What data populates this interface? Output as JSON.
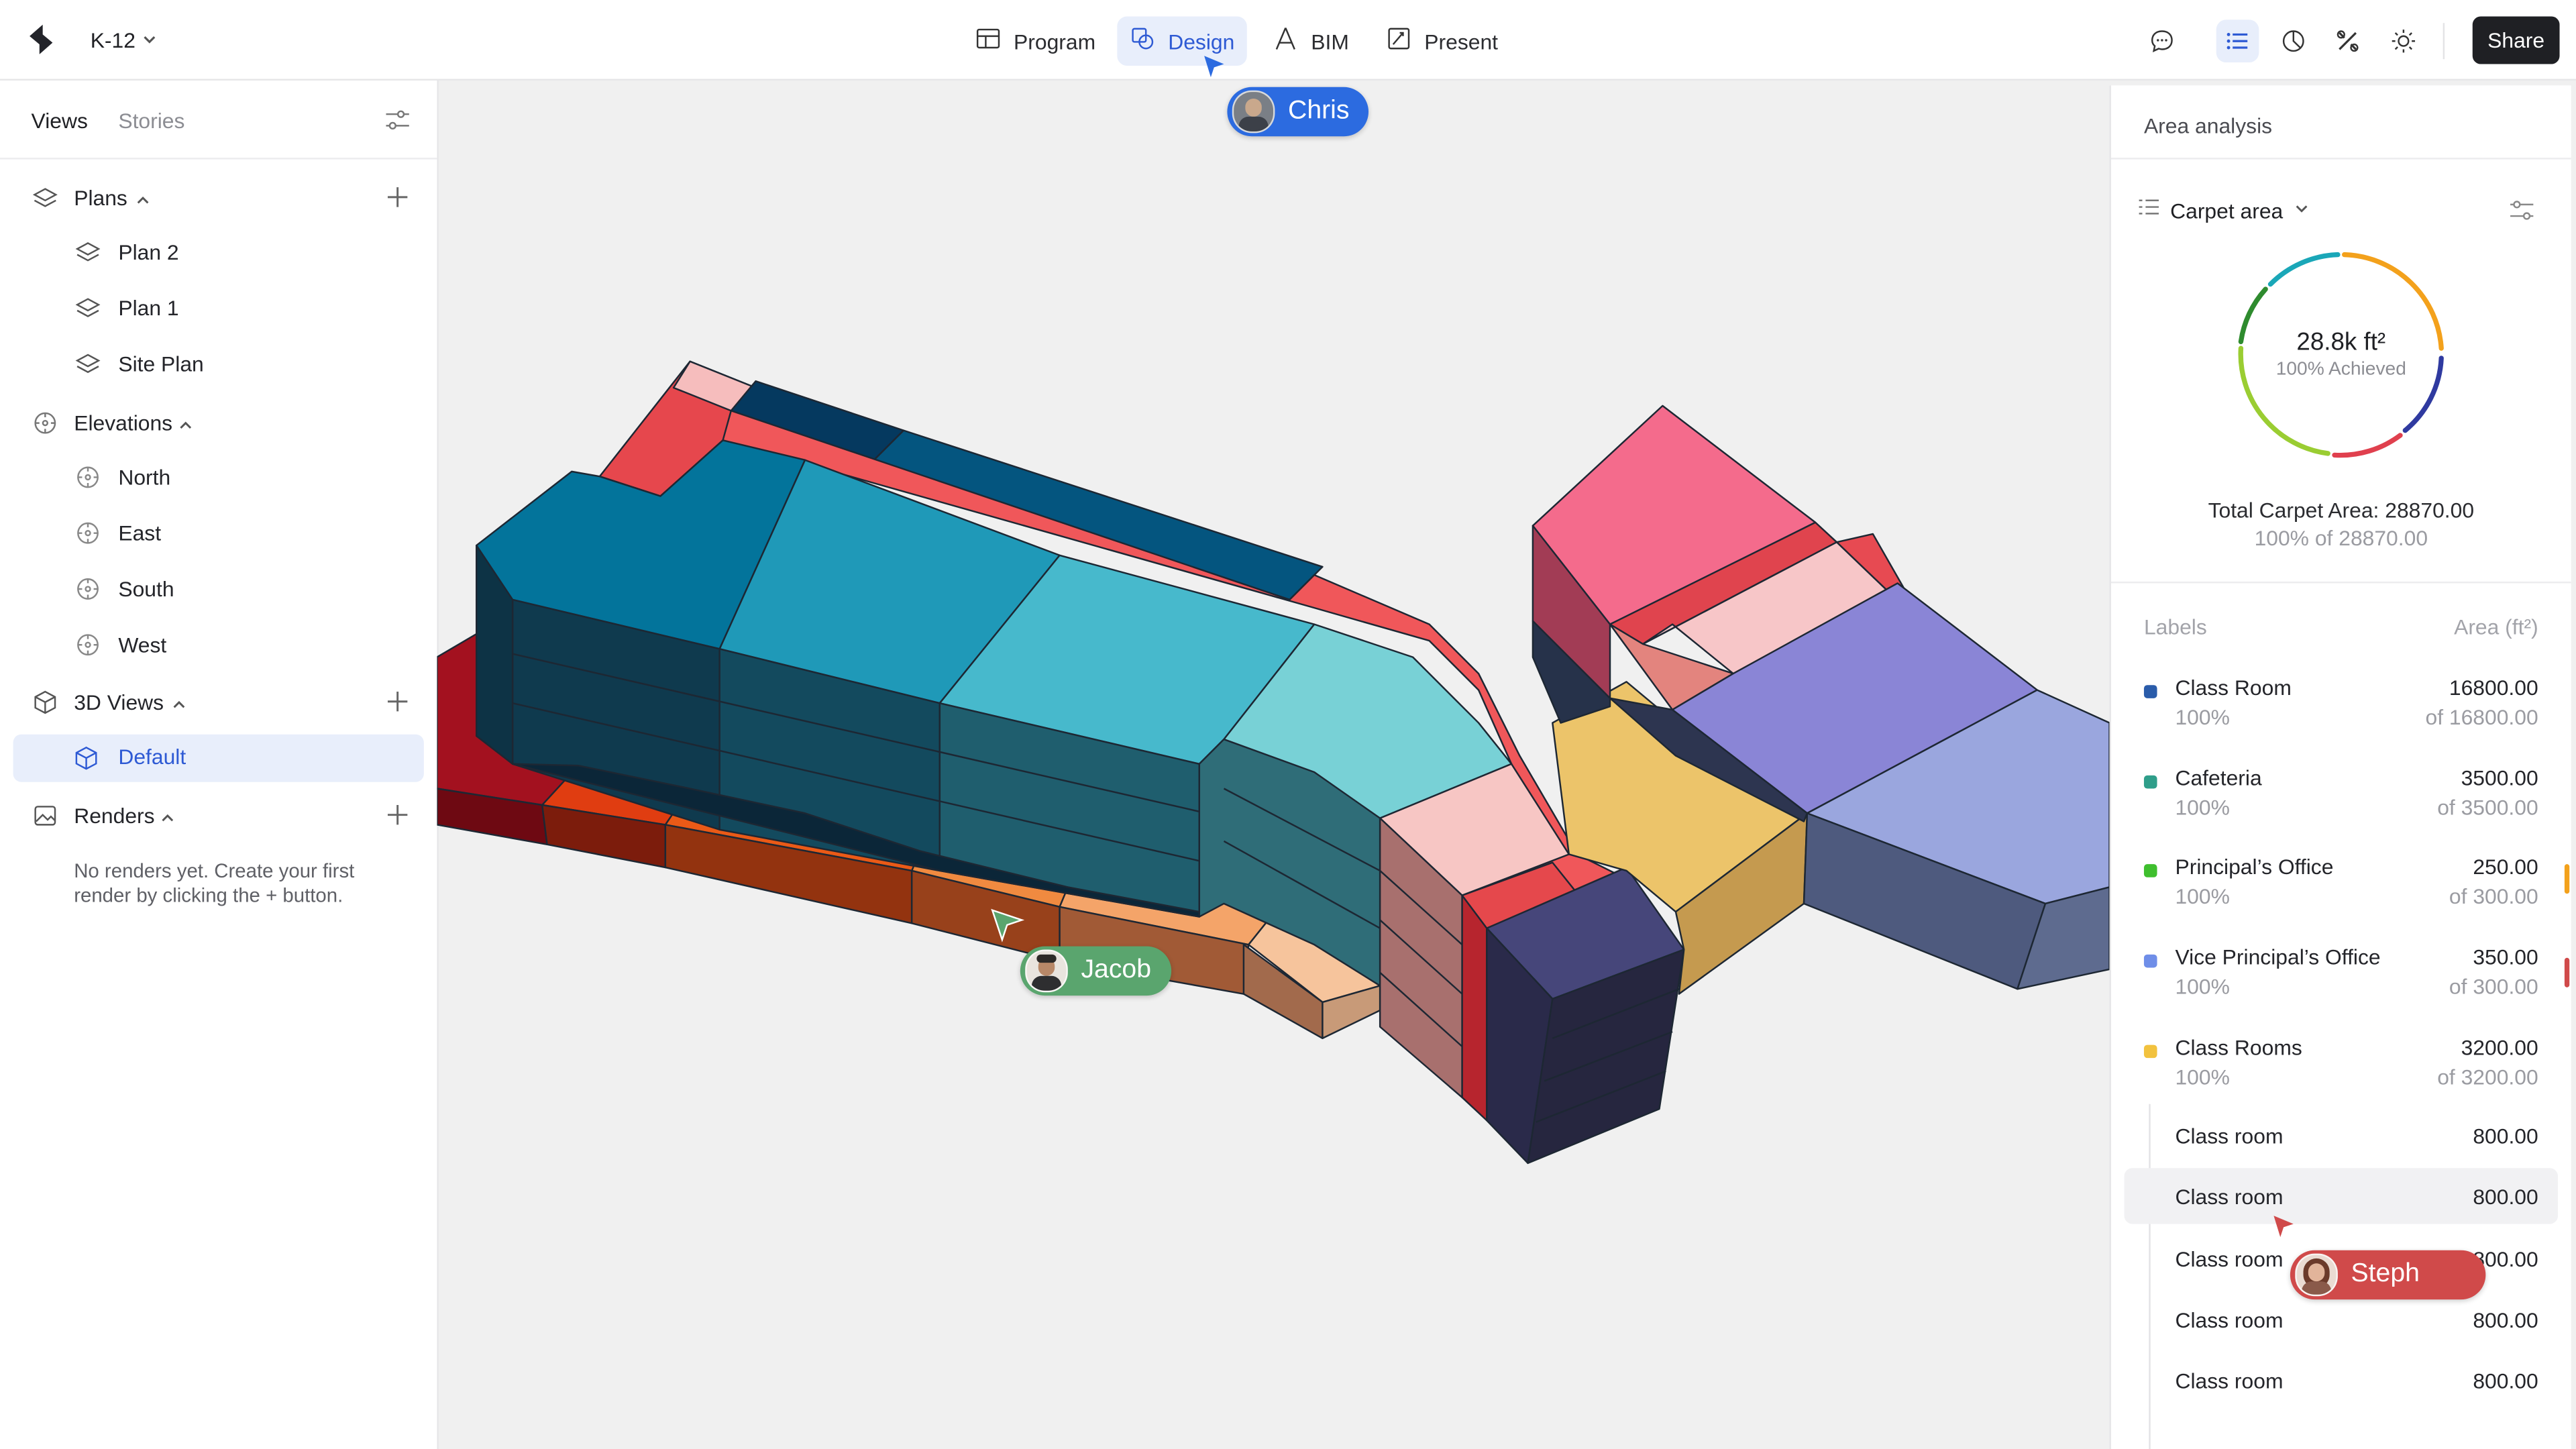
{
  "project": {
    "name": "K-12"
  },
  "modes": [
    {
      "label": "Program"
    },
    {
      "label": "Design"
    },
    {
      "label": "BIM"
    },
    {
      "label": "Present"
    }
  ],
  "share_label": "Share",
  "left_panel": {
    "tabs": [
      "Views",
      "Stories"
    ],
    "sections": {
      "plans": {
        "label": "Plans",
        "items": [
          "Plan 2",
          "Plan 1",
          "Site Plan"
        ]
      },
      "elevations": {
        "label": "Elevations",
        "items": [
          "North",
          "East",
          "South",
          "West"
        ]
      },
      "views3d": {
        "label": "3D Views",
        "items": [
          "Default"
        ]
      },
      "renders": {
        "label": "Renders",
        "empty_text": "No renders yet. Create your first render by clicking the + button."
      }
    }
  },
  "right_panel": {
    "title": "Area analysis",
    "metric": "Carpet area",
    "donut": {
      "center_value": "28.8k ft²",
      "center_caption": "100% Achieved"
    },
    "total_line": "Total Carpet Area: 28870.00",
    "total_sub": "100% of 28870.00",
    "labels_header": "Labels",
    "area_header": "Area (ft²)",
    "labels": [
      {
        "name": "Class Room",
        "pct": "100%",
        "value": "16800.00",
        "of": "of 16800.00",
        "color": "#2a5caa"
      },
      {
        "name": "Cafeteria",
        "pct": "100%",
        "value": "3500.00",
        "of": "of 3500.00",
        "color": "#2f9e8a"
      },
      {
        "name": "Principal’s Office",
        "pct": "100%",
        "value": "250.00",
        "of": "of 300.00",
        "color": "#3fbf2e"
      },
      {
        "name": "Vice Principal’s Office",
        "pct": "100%",
        "value": "350.00",
        "of": "of 300.00",
        "color": "#6f8ee8"
      },
      {
        "name": "Class Rooms",
        "pct": "100%",
        "value": "3200.00",
        "of": "of 3200.00",
        "color": "#f2c23e"
      }
    ],
    "sub_rows": [
      {
        "name": "Class room",
        "value": "800.00"
      },
      {
        "name": "Class room",
        "value": "800.00"
      },
      {
        "name": "Class room",
        "value": "800.00"
      },
      {
        "name": "Class room",
        "value": "800.00"
      },
      {
        "name": "Class room",
        "value": "800.00"
      }
    ]
  },
  "collaborators": [
    {
      "name": "Chris",
      "color": "#2c6be0"
    },
    {
      "name": "Jacob",
      "color": "#5aa56e"
    },
    {
      "name": "Steph",
      "color": "#d04a4a"
    }
  ]
}
